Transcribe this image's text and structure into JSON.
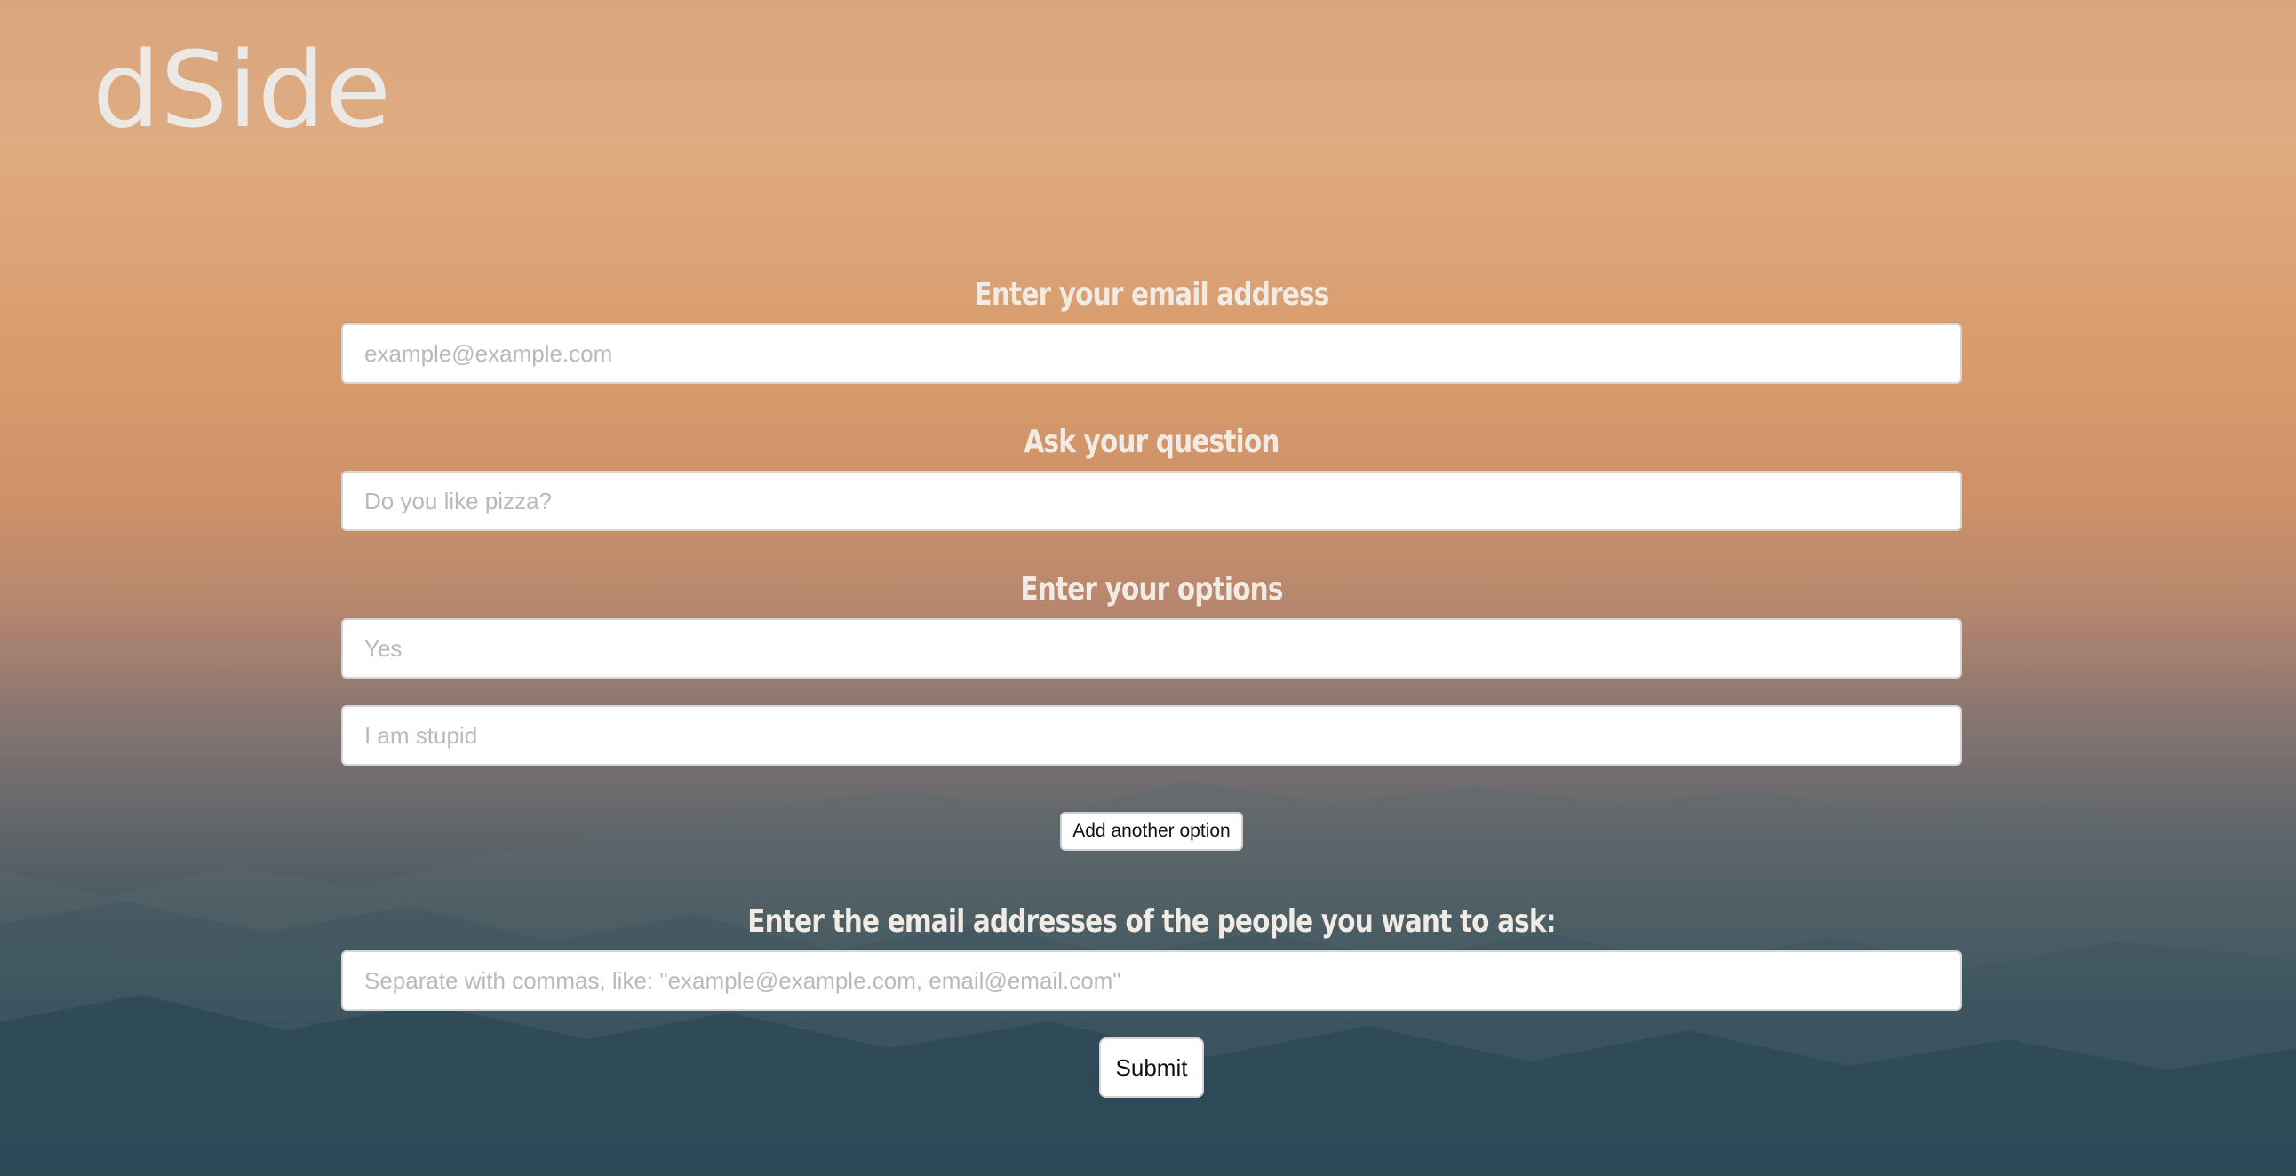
{
  "brand": {
    "logo_text": "dSide"
  },
  "form": {
    "email_heading": "Enter your email address",
    "email_placeholder": "example@example.com",
    "question_heading": "Ask your question",
    "question_placeholder": "Do you like pizza?",
    "options_heading": "Enter your options",
    "options": [
      {
        "placeholder": "Yes"
      },
      {
        "placeholder": "I am stupid"
      }
    ],
    "add_option_label": "Add another option",
    "recipients_heading": "Enter the email addresses of the people you want to ask:",
    "recipients_placeholder": "Separate with commas, like: \"example@example.com, email@email.com\"",
    "submit_label": "Submit"
  },
  "colors": {
    "heading_text": "#f2ebe4",
    "logo": "#ece8e4",
    "sky_top": "#dfab80",
    "sky_bottom": "#1d3e4f"
  }
}
